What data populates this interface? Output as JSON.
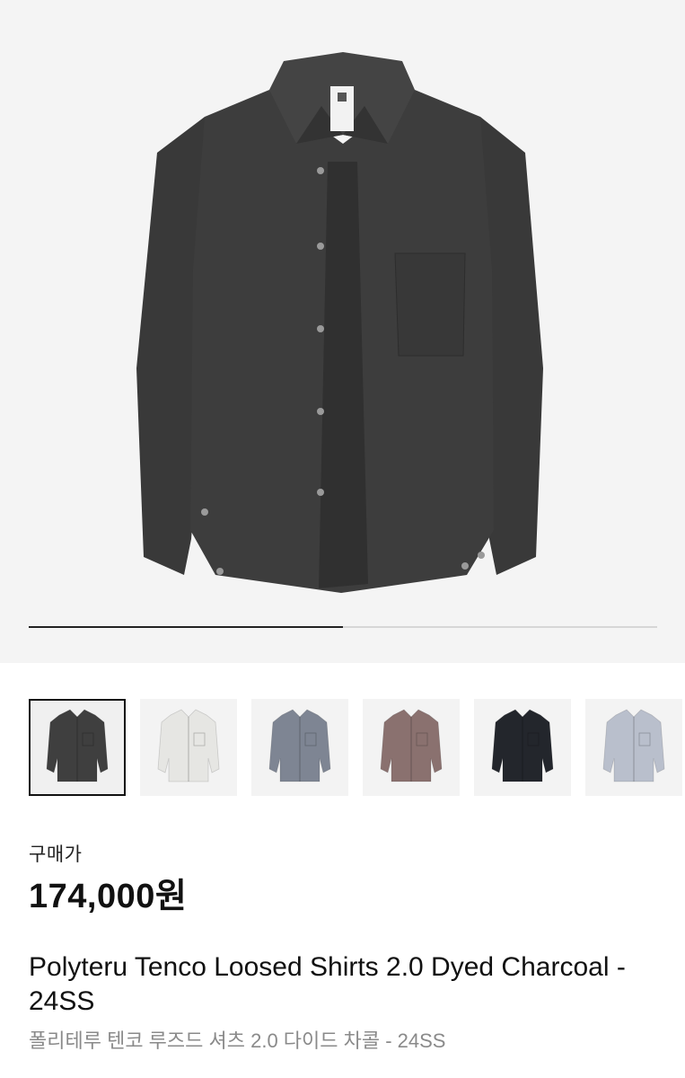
{
  "product": {
    "image_alt": "Charcoal loosed shirt front view",
    "gallery_progress": 0.5,
    "price_label": "구매가",
    "price": "174,000원",
    "title": "Polyteru Tenco Loosed Shirts 2.0 Dyed Charcoal - 24SS",
    "subtitle_ko": "폴리테루 텐코 루즈드 셔츠 2.0 다이드 차콜 - 24SS"
  },
  "colors": {
    "hero_background": "#f4f4f4",
    "shirt_main": "#3d3d3d",
    "thumb_variants": [
      "#3f3f3f",
      "#e6e6e3",
      "#7e8593",
      "#8a716f",
      "#23262c",
      "#b9bfcc"
    ],
    "selected_outline": "#111111"
  },
  "thumbnails": [
    {
      "name": "charcoal",
      "selected": true
    },
    {
      "name": "ivory",
      "selected": false
    },
    {
      "name": "blue-grey",
      "selected": false
    },
    {
      "name": "brown",
      "selected": false
    },
    {
      "name": "navy",
      "selected": false
    },
    {
      "name": "light-blue",
      "selected": false
    }
  ]
}
